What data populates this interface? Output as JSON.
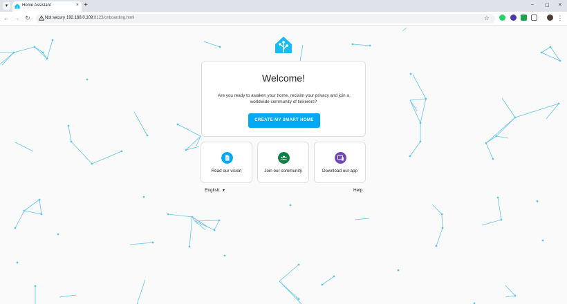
{
  "browser": {
    "tab_title": "Home Assistant",
    "tab_close": "×",
    "new_tab": "+",
    "menu_caret": "▾",
    "security_label": "Not secure",
    "url_host": "192.168.0.109",
    "url_rest": ":8123/onboarding.html",
    "window_controls": [
      "–",
      "▢",
      "✕"
    ],
    "nav": {
      "back": "←",
      "forward": "→",
      "reload": "↻"
    },
    "star": "☆",
    "more": "⋮",
    "extension_icons": [
      "whatsapp-icon",
      "extension-badge-icon",
      "shield-check-icon",
      "puzzle-icon",
      "profile-avatar-icon"
    ]
  },
  "onboarding": {
    "title": "Welcome!",
    "intro": "Are you ready to awaken your home, reclaim your privacy and join a worldwide community of tinkerers?",
    "cta_label": "CREATE MY SMART HOME",
    "links": [
      {
        "label": "Read our vision",
        "icon": "document-icon",
        "color": "#03a9f4"
      },
      {
        "label": "Join our community",
        "icon": "people-icon",
        "color": "#0b8043"
      },
      {
        "label": "Download our app",
        "icon": "devices-icon",
        "color": "#6d46b8"
      }
    ],
    "language": "English",
    "language_caret": "▾",
    "help": "Help"
  },
  "colors": {
    "accent": "#03a9f4",
    "network": "#5ec4ee",
    "background": "#fafafa"
  }
}
